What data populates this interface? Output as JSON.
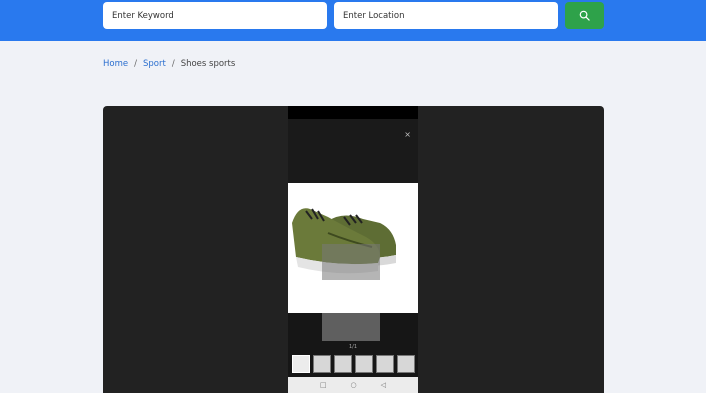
{
  "header": {
    "keyword_placeholder": "Enter Keyword",
    "location_placeholder": "Enter Location",
    "search_icon": "search-icon",
    "accent": "#2979ee",
    "button_color": "#2ea24a"
  },
  "breadcrumb": {
    "home": "Home",
    "category": "Sport",
    "current": "Shoes sports"
  },
  "viewer": {
    "close_label": "×",
    "counter": "1/1",
    "thumbnail_count": 7,
    "nav_icons": [
      "square-icon",
      "circle-icon",
      "back-triangle-icon"
    ]
  }
}
